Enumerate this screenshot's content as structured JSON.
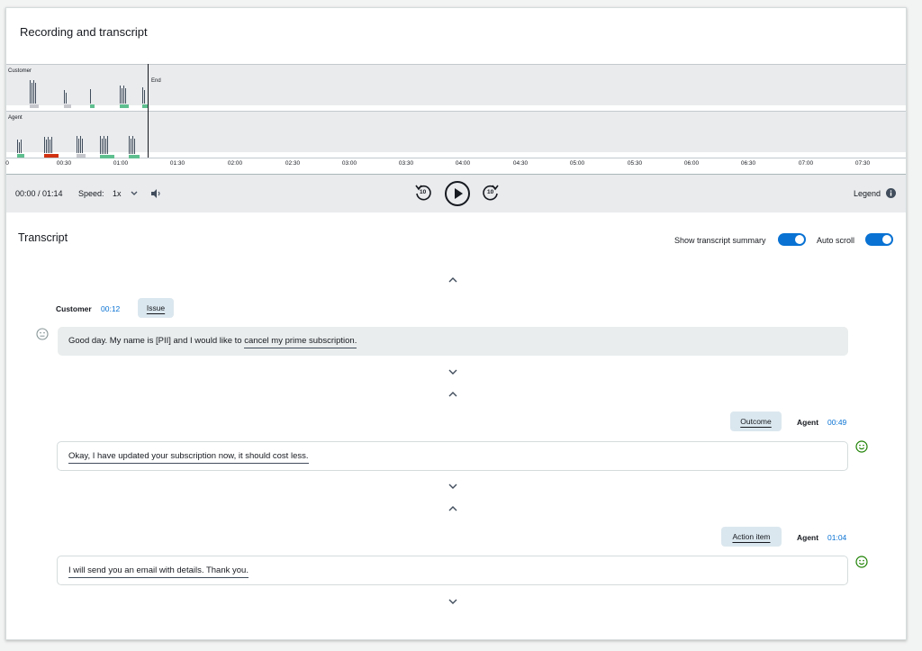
{
  "header": {
    "title": "Recording and transcript"
  },
  "timeline": {
    "customer_label": "Customer",
    "agent_label": "Agent",
    "end_label": "End",
    "ticks": [
      "0",
      "00:30",
      "01:00",
      "01:30",
      "02:00",
      "02:30",
      "03:00",
      "03:30",
      "04:00",
      "04:30",
      "05:00",
      "05:30",
      "06:00",
      "06:30",
      "07:00",
      "07:30"
    ]
  },
  "player": {
    "time": "00:00 / 01:14",
    "speed_label": "Speed:",
    "speed_value": "1x",
    "rewind_label": "10",
    "forward_label": "10",
    "legend_label": "Legend"
  },
  "transcript": {
    "title": "Transcript",
    "summary_toggle_label": "Show transcript summary",
    "autoscroll_label": "Auto scroll",
    "turns": [
      {
        "speaker": "Customer",
        "time": "00:12",
        "tag": "Issue",
        "text_plain": "Good day. My name is [PII] and I would like to ",
        "text_highlight": "cancel my prime subscription."
      },
      {
        "speaker": "Agent",
        "time": "00:49",
        "tag": "Outcome",
        "text_highlight": "Okay, I have updated your subscription now, it should cost less."
      },
      {
        "speaker": "Agent",
        "time": "01:04",
        "tag": "Action item",
        "text_highlight": "I will send you an email with details. Thank you."
      }
    ]
  },
  "colors": {
    "accent": "#0972d3",
    "positive": "#1d8102",
    "negative": "#d13212",
    "neutral": "#c6c6cd",
    "mixed_positive": "#5fbf8f"
  }
}
